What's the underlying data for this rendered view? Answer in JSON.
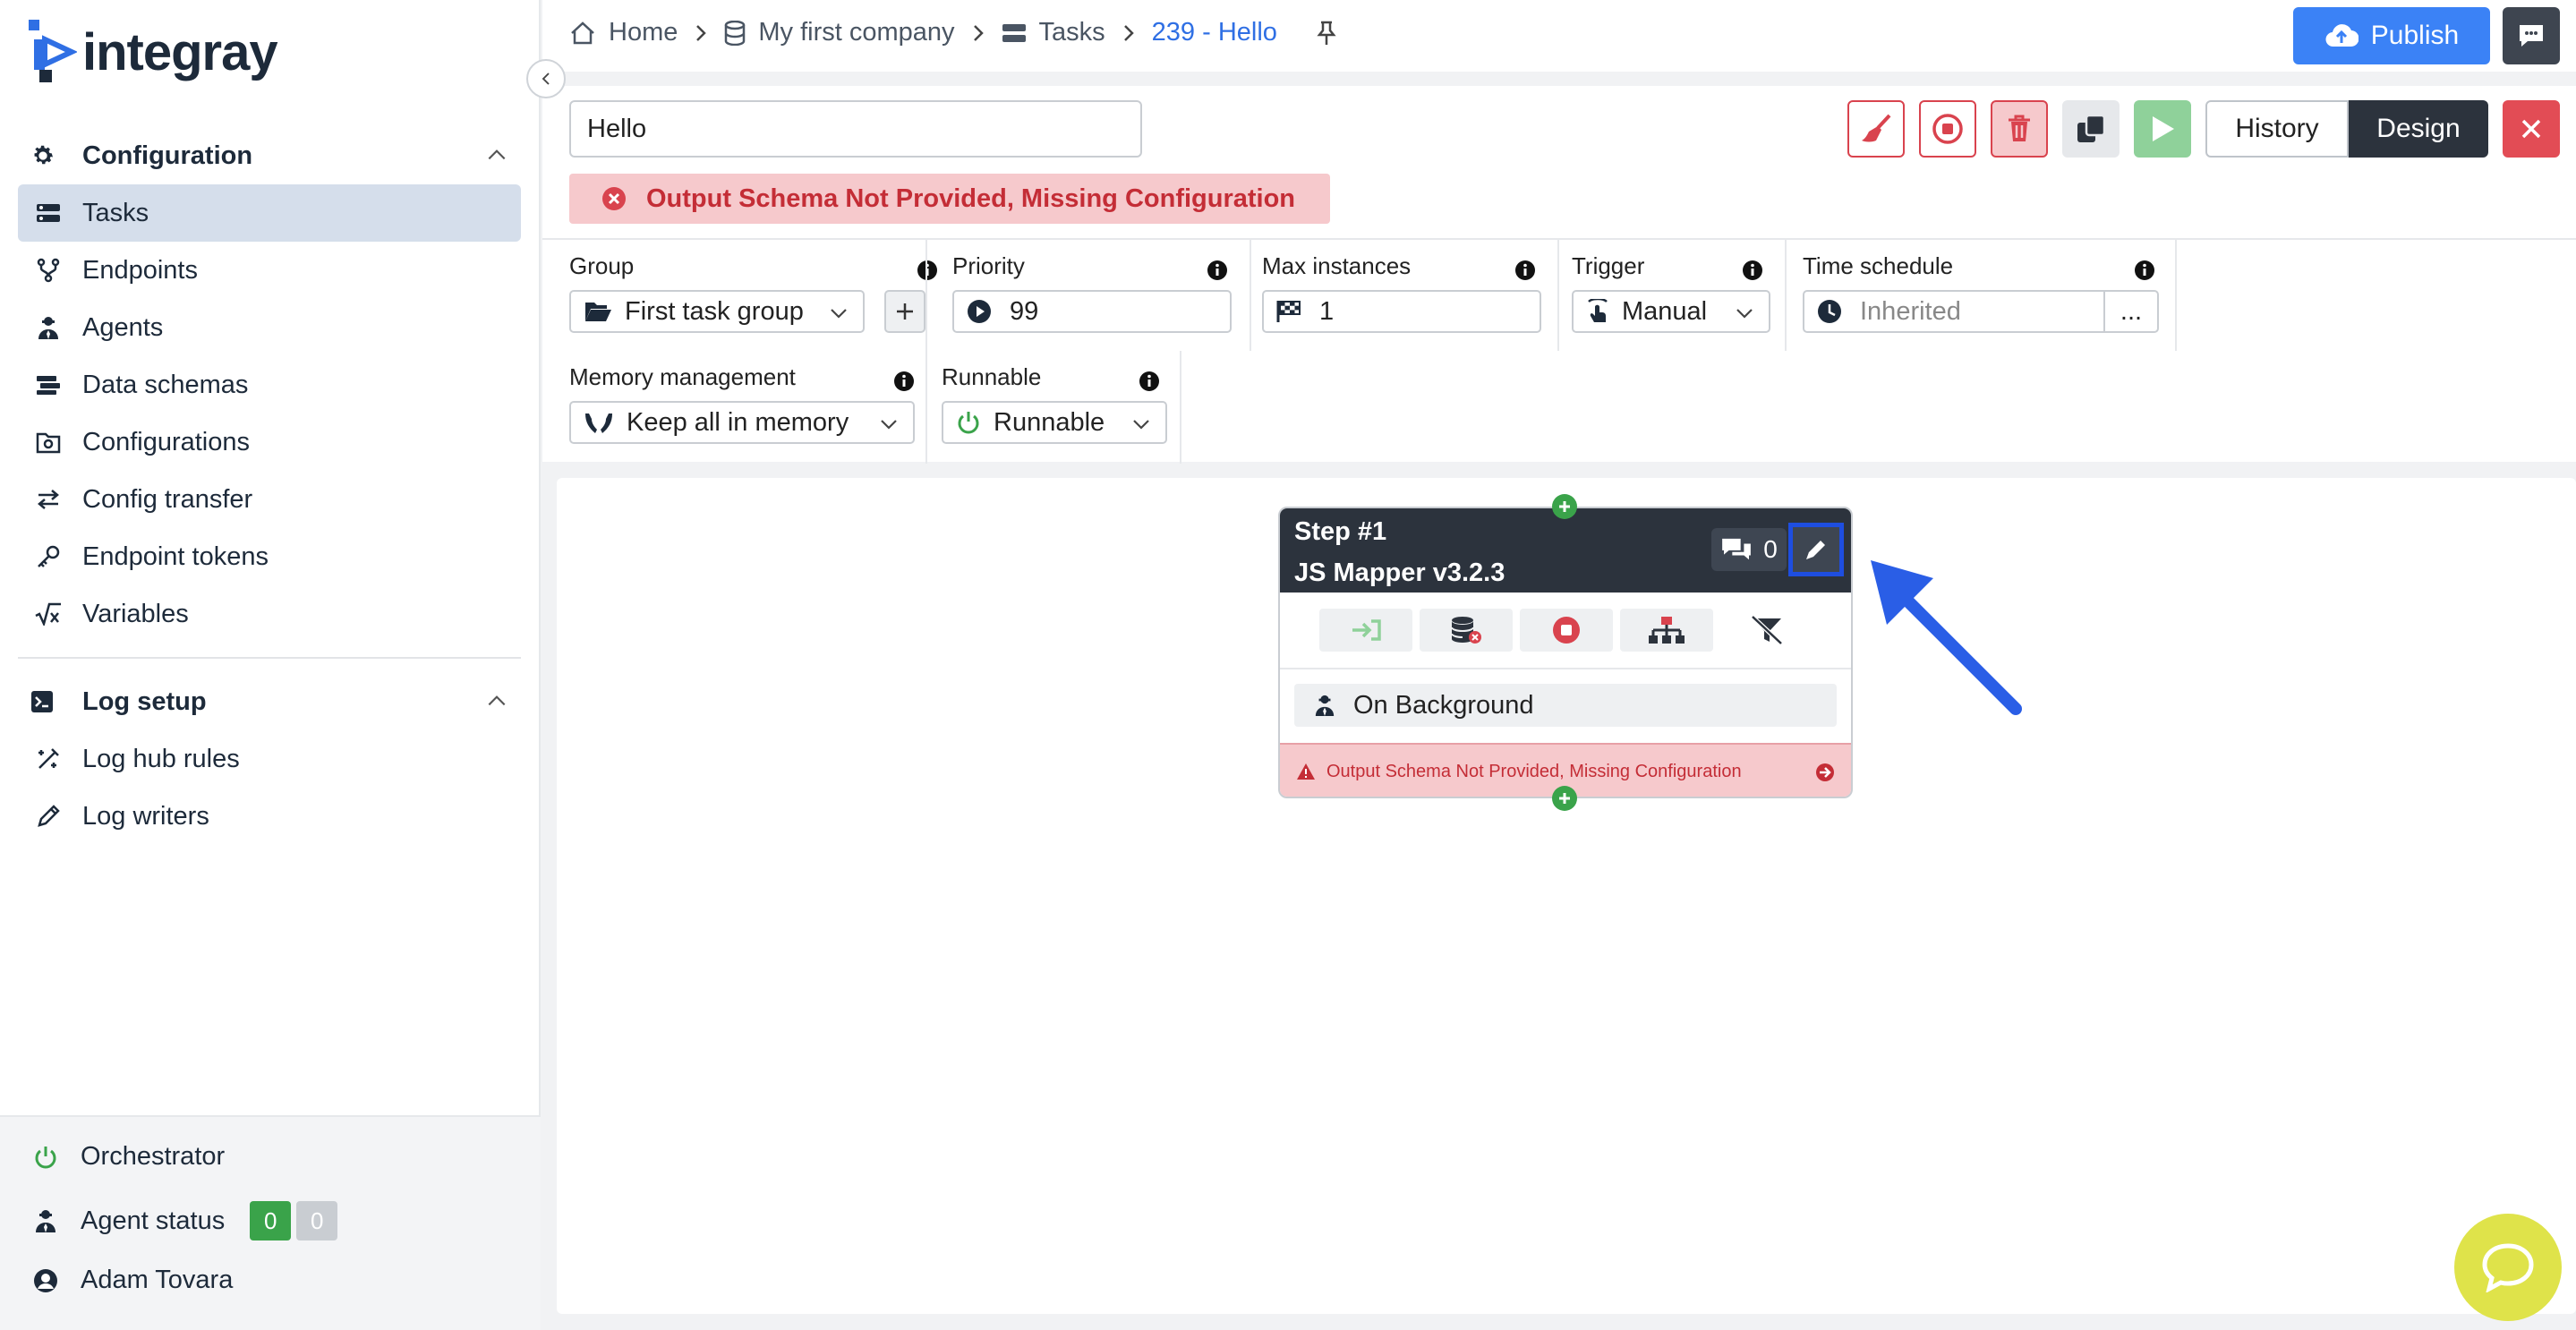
{
  "app": {
    "logo_text": "integray"
  },
  "sidebar": {
    "config_header": "Configuration",
    "items": [
      {
        "label": "Tasks",
        "icon": "tasks-icon"
      },
      {
        "label": "Endpoints",
        "icon": "endpoints-icon"
      },
      {
        "label": "Agents",
        "icon": "agent-icon"
      },
      {
        "label": "Data schemas",
        "icon": "data-schema-icon"
      },
      {
        "label": "Configurations",
        "icon": "configurations-icon"
      },
      {
        "label": "Config transfer",
        "icon": "transfer-icon"
      },
      {
        "label": "Endpoint tokens",
        "icon": "key-icon"
      },
      {
        "label": "Variables",
        "icon": "variables-icon"
      }
    ],
    "log_header": "Log setup",
    "log_items": [
      {
        "label": "Log hub rules",
        "icon": "log-rules-icon"
      },
      {
        "label": "Log writers",
        "icon": "pen-icon"
      }
    ],
    "footer": {
      "orchestrator": "Orchestrator",
      "agent_status": "Agent status",
      "agent_ok": "0",
      "agent_off": "0",
      "user": "Adam Tovara"
    }
  },
  "breadcrumb": {
    "home": "Home",
    "company": "My first company",
    "tasks": "Tasks",
    "current": "239 - Hello"
  },
  "header": {
    "publish_label": "Publish"
  },
  "task": {
    "name": "Hello",
    "error": "Output Schema Not Provided, Missing Configuration"
  },
  "toolbar": {
    "history_label": "History",
    "design_label": "Design"
  },
  "fields": {
    "group": {
      "label": "Group",
      "value": "First task group"
    },
    "priority": {
      "label": "Priority",
      "value": "99"
    },
    "max_instances": {
      "label": "Max instances",
      "value": "1"
    },
    "trigger": {
      "label": "Trigger",
      "value": "Manual"
    },
    "time_schedule": {
      "label": "Time schedule",
      "placeholder": "Inherited",
      "more": "..."
    },
    "memory": {
      "label": "Memory management",
      "value": "Keep all in memory"
    },
    "runnable": {
      "label": "Runnable",
      "value": "Runnable"
    }
  },
  "comments_count": "0",
  "step": {
    "title": "Step #1",
    "subtitle": "JS Mapper v3.2.3",
    "comments": "0",
    "agent": "On Background",
    "error": "Output Schema Not Provided, Missing Configuration"
  },
  "colors": {
    "accent": "#3b82f6",
    "dark": "#2c333d",
    "error_bg": "#f6c9cc",
    "error_text": "#c42d36",
    "success": "#3aa34a",
    "highlight": "#1e4ee0"
  }
}
